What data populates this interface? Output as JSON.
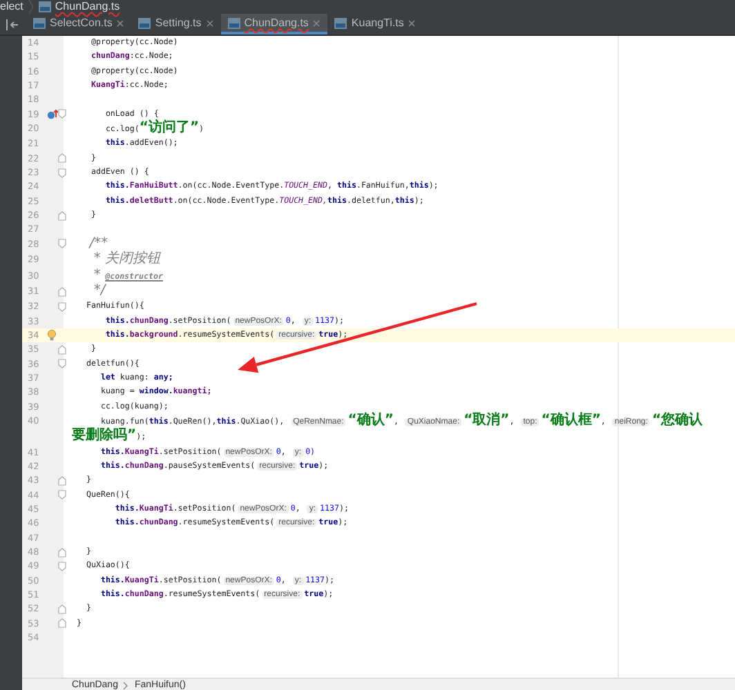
{
  "breadcrumb_bar": {
    "items": [
      {
        "text": "elect",
        "kind": "folder"
      },
      {
        "text": "ChunDang.ts",
        "kind": "file"
      }
    ]
  },
  "tabs": [
    {
      "label": "SelectCon.ts",
      "selected": false
    },
    {
      "label": "Setting.ts",
      "selected": false
    },
    {
      "label": "ChunDang.ts",
      "selected": true
    },
    {
      "label": "KuangTi.ts",
      "selected": false
    }
  ],
  "editor": {
    "lines": [
      {
        "number": "14",
        "current": false,
        "tokens": [
          {
            "kind": "plain",
            "text": "    @property(cc.Node)"
          }
        ]
      },
      {
        "number": "15",
        "current": false,
        "tokens": [
          {
            "kind": "field",
            "text": "    chunDang"
          },
          {
            "kind": "plain",
            "text": ":cc.Node;"
          }
        ]
      },
      {
        "number": "16",
        "current": false,
        "tokens": [
          {
            "kind": "plain",
            "text": "    @property(cc.Node)"
          }
        ]
      },
      {
        "number": "17",
        "current": false,
        "tokens": [
          {
            "kind": "field",
            "text": "    KuangTi"
          },
          {
            "kind": "plain",
            "text": ":cc.Node;"
          }
        ]
      },
      {
        "number": "18",
        "current": false
      },
      {
        "number": "19",
        "current": false,
        "tokens": [
          {
            "kind": "plain",
            "text": "       onLoad () {"
          }
        ]
      },
      {
        "number": "20",
        "current": false,
        "tokens": [
          {
            "kind": "plain",
            "text": "       cc.log("
          },
          {
            "kind": "str",
            "text": "“访问了”"
          },
          {
            "kind": "plain",
            "text": ")"
          }
        ]
      },
      {
        "number": "21",
        "current": false,
        "tokens": [
          {
            "kind": "kw",
            "text": "       this"
          },
          {
            "kind": "plain",
            "text": ".addEven();"
          }
        ]
      },
      {
        "number": "22",
        "current": false,
        "tokens": [
          {
            "kind": "plain",
            "text": "    }"
          }
        ]
      },
      {
        "number": "23",
        "current": false,
        "tokens": [
          {
            "kind": "plain",
            "text": "    addEven () {"
          }
        ]
      },
      {
        "number": "24",
        "current": false,
        "tokens": [
          {
            "kind": "kw",
            "text": "       this."
          },
          {
            "kind": "field",
            "text": "FanHuiButt"
          },
          {
            "kind": "plain",
            "text": ".on(cc.Node.EventType."
          },
          {
            "kind": "const",
            "text": "TOUCH_END"
          },
          {
            "kind": "plain",
            "text": ", "
          },
          {
            "kind": "kw",
            "text": "this"
          },
          {
            "kind": "plain",
            "text": ".FanHuifun,"
          },
          {
            "kind": "kw",
            "text": "this"
          },
          {
            "kind": "plain",
            "text": ");"
          }
        ]
      },
      {
        "number": "25",
        "current": false,
        "tokens": [
          {
            "kind": "kw",
            "text": "       this."
          },
          {
            "kind": "field",
            "text": "deletButt"
          },
          {
            "kind": "plain",
            "text": ".on(cc.Node.EventType."
          },
          {
            "kind": "const",
            "text": "TOUCH_END,"
          },
          {
            "kind": "kw",
            "text": "this"
          },
          {
            "kind": "plain",
            "text": ".deletfun,"
          },
          {
            "kind": "kw",
            "text": "this"
          },
          {
            "kind": "plain",
            "text": ");"
          }
        ]
      },
      {
        "number": "26",
        "current": false,
        "tokens": [
          {
            "kind": "plain",
            "text": "    }"
          }
        ]
      },
      {
        "number": "27",
        "current": false
      },
      {
        "number": "28",
        "current": false,
        "tokens": [
          {
            "kind": "comment",
            "text": "    /**"
          }
        ]
      },
      {
        "number": "29",
        "current": false,
        "tokens": [
          {
            "kind": "comment",
            "text": "     * 关闭按钮"
          }
        ]
      },
      {
        "number": "30",
        "current": false,
        "tokens": [
          {
            "kind": "comment",
            "text": "     * "
          },
          {
            "kind": "doc",
            "text": "@constructor"
          }
        ]
      },
      {
        "number": "31",
        "current": false,
        "tokens": [
          {
            "kind": "comment",
            "text": "     */"
          }
        ]
      },
      {
        "number": "32",
        "current": false,
        "tokens": [
          {
            "kind": "plain",
            "text": "   FanHuifun(){"
          }
        ]
      },
      {
        "number": "33",
        "current": false,
        "tokens": [
          {
            "kind": "kw",
            "text": "       this."
          },
          {
            "kind": "field",
            "text": "chunDang"
          },
          {
            "kind": "plain",
            "text": ".setPosition("
          },
          {
            "kind": "hint",
            "text": "newPosOrX:"
          },
          {
            "kind": "num",
            "text": "0"
          },
          {
            "kind": "plain",
            "text": ", "
          },
          {
            "kind": "hint",
            "text": "y:"
          },
          {
            "kind": "num",
            "text": "1137"
          },
          {
            "kind": "plain",
            "text": ");"
          }
        ]
      },
      {
        "number": "34",
        "current": true,
        "tokens": [
          {
            "kind": "kw",
            "text": "       this."
          },
          {
            "kind": "field",
            "text": "background"
          },
          {
            "kind": "plain",
            "text": ".resumeSystemEvents("
          },
          {
            "kind": "hint",
            "text": "recursive:"
          },
          {
            "kind": "kw",
            "text": "true"
          },
          {
            "kind": "plain",
            "text": ");"
          }
        ]
      },
      {
        "number": "35",
        "current": false,
        "tokens": [
          {
            "kind": "plain",
            "text": "    }"
          }
        ]
      },
      {
        "number": "36",
        "current": false,
        "tokens": [
          {
            "kind": "plain",
            "text": "   deletfun(){"
          }
        ]
      },
      {
        "number": "37",
        "current": false,
        "tokens": [
          {
            "kind": "kw",
            "text": "      let"
          },
          {
            "kind": "plain",
            "text": " kuang: "
          },
          {
            "kind": "kw",
            "text": "any;"
          }
        ]
      },
      {
        "number": "38",
        "current": false,
        "tokens": [
          {
            "kind": "plain",
            "text": "      kuang = "
          },
          {
            "kind": "kw",
            "text": "window."
          },
          {
            "kind": "field",
            "text": "kuangti;"
          }
        ]
      },
      {
        "number": "39",
        "current": false,
        "tokens": [
          {
            "kind": "plain",
            "text": "      cc.log(kuang);"
          }
        ]
      },
      {
        "number": "40",
        "current": false,
        "tokens": [
          {
            "kind": "plain",
            "text": "      kuang.fun("
          },
          {
            "kind": "kw",
            "text": "this"
          },
          {
            "kind": "plain",
            "text": ".QueRen(),"
          },
          {
            "kind": "kw",
            "text": "this"
          },
          {
            "kind": "plain",
            "text": ".QuXiao(), "
          },
          {
            "kind": "hint",
            "text": "QeRenNmae:"
          },
          {
            "kind": "str",
            "text": "“确认”"
          },
          {
            "kind": "plain",
            "text": ", "
          },
          {
            "kind": "hint",
            "text": "QuXiaoNmae:"
          },
          {
            "kind": "str",
            "text": "“取消”"
          },
          {
            "kind": "plain",
            "text": ", "
          },
          {
            "kind": "hint",
            "text": "top:"
          },
          {
            "kind": "str",
            "text": "“确认框”"
          },
          {
            "kind": "plain",
            "text": ", "
          },
          {
            "kind": "hint",
            "text": "neiRong:"
          },
          {
            "kind": "str",
            "text": "“您确认要删除吗”"
          },
          {
            "kind": "plain",
            "text": ");"
          }
        ]
      },
      {
        "number": "41",
        "current": false,
        "tokens": [
          {
            "kind": "kw",
            "text": "      this."
          },
          {
            "kind": "field",
            "text": "KuangTi"
          },
          {
            "kind": "plain",
            "text": ".setPosition("
          },
          {
            "kind": "hint",
            "text": "newPosOrX:"
          },
          {
            "kind": "num",
            "text": "0"
          },
          {
            "kind": "plain",
            "text": ", "
          },
          {
            "kind": "hint",
            "text": "y:"
          },
          {
            "kind": "num",
            "text": "0)"
          }
        ]
      },
      {
        "number": "42",
        "current": false,
        "tokens": [
          {
            "kind": "kw",
            "text": "      this."
          },
          {
            "kind": "field",
            "text": "chunDang"
          },
          {
            "kind": "plain",
            "text": ".pauseSystemEvents("
          },
          {
            "kind": "hint",
            "text": "recursive:"
          },
          {
            "kind": "kw",
            "text": "true"
          },
          {
            "kind": "plain",
            "text": ");"
          }
        ]
      },
      {
        "number": "43",
        "current": false,
        "tokens": [
          {
            "kind": "plain",
            "text": "   }"
          }
        ]
      },
      {
        "number": "44",
        "current": false,
        "tokens": [
          {
            "kind": "plain",
            "text": "   QueRen(){"
          }
        ]
      },
      {
        "number": "45",
        "current": false,
        "tokens": [
          {
            "kind": "kw",
            "text": "         this."
          },
          {
            "kind": "field",
            "text": "KuangTi"
          },
          {
            "kind": "plain",
            "text": ".setPosition("
          },
          {
            "kind": "hint",
            "text": "newPosOrX:"
          },
          {
            "kind": "num",
            "text": "0"
          },
          {
            "kind": "plain",
            "text": ", "
          },
          {
            "kind": "hint",
            "text": "y:"
          },
          {
            "kind": "num",
            "text": "1137"
          },
          {
            "kind": "plain",
            "text": ");"
          }
        ]
      },
      {
        "number": "46",
        "current": false,
        "tokens": [
          {
            "kind": "kw",
            "text": "         this."
          },
          {
            "kind": "field",
            "text": "chunDang"
          },
          {
            "kind": "plain",
            "text": ".resumeSystemEvents("
          },
          {
            "kind": "hint",
            "text": "recursive:"
          },
          {
            "kind": "kw",
            "text": "true"
          },
          {
            "kind": "plain",
            "text": ");"
          }
        ]
      },
      {
        "number": "47",
        "current": false
      },
      {
        "number": "48",
        "current": false,
        "tokens": [
          {
            "kind": "plain",
            "text": "   }"
          }
        ]
      },
      {
        "number": "49",
        "current": false,
        "tokens": [
          {
            "kind": "plain",
            "text": "   QuXiao(){"
          }
        ]
      },
      {
        "number": "50",
        "current": false,
        "tokens": [
          {
            "kind": "kw",
            "text": "      this."
          },
          {
            "kind": "field",
            "text": "KuangTi"
          },
          {
            "kind": "plain",
            "text": ".setPosition("
          },
          {
            "kind": "hint",
            "text": "newPosOrX:"
          },
          {
            "kind": "num",
            "text": "0"
          },
          {
            "kind": "plain",
            "text": ", "
          },
          {
            "kind": "hint",
            "text": "y:"
          },
          {
            "kind": "num",
            "text": "1137"
          },
          {
            "kind": "plain",
            "text": ");"
          }
        ]
      },
      {
        "number": "51",
        "current": false,
        "tokens": [
          {
            "kind": "kw",
            "text": "      this."
          },
          {
            "kind": "field",
            "text": "chunDang"
          },
          {
            "kind": "plain",
            "text": ".resumeSystemEvents("
          },
          {
            "kind": "hint",
            "text": "recursive:"
          },
          {
            "kind": "kw",
            "text": "true"
          },
          {
            "kind": "plain",
            "text": ");"
          }
        ]
      },
      {
        "number": "52",
        "current": false,
        "tokens": [
          {
            "kind": "plain",
            "text": "   }"
          }
        ]
      },
      {
        "number": "53",
        "current": false,
        "tokens": [
          {
            "kind": "plain",
            "text": " }"
          }
        ]
      },
      {
        "number": "54",
        "current": false
      }
    ]
  },
  "status_breadcrumb": [
    "ChunDang",
    "FanHuifun()"
  ]
}
